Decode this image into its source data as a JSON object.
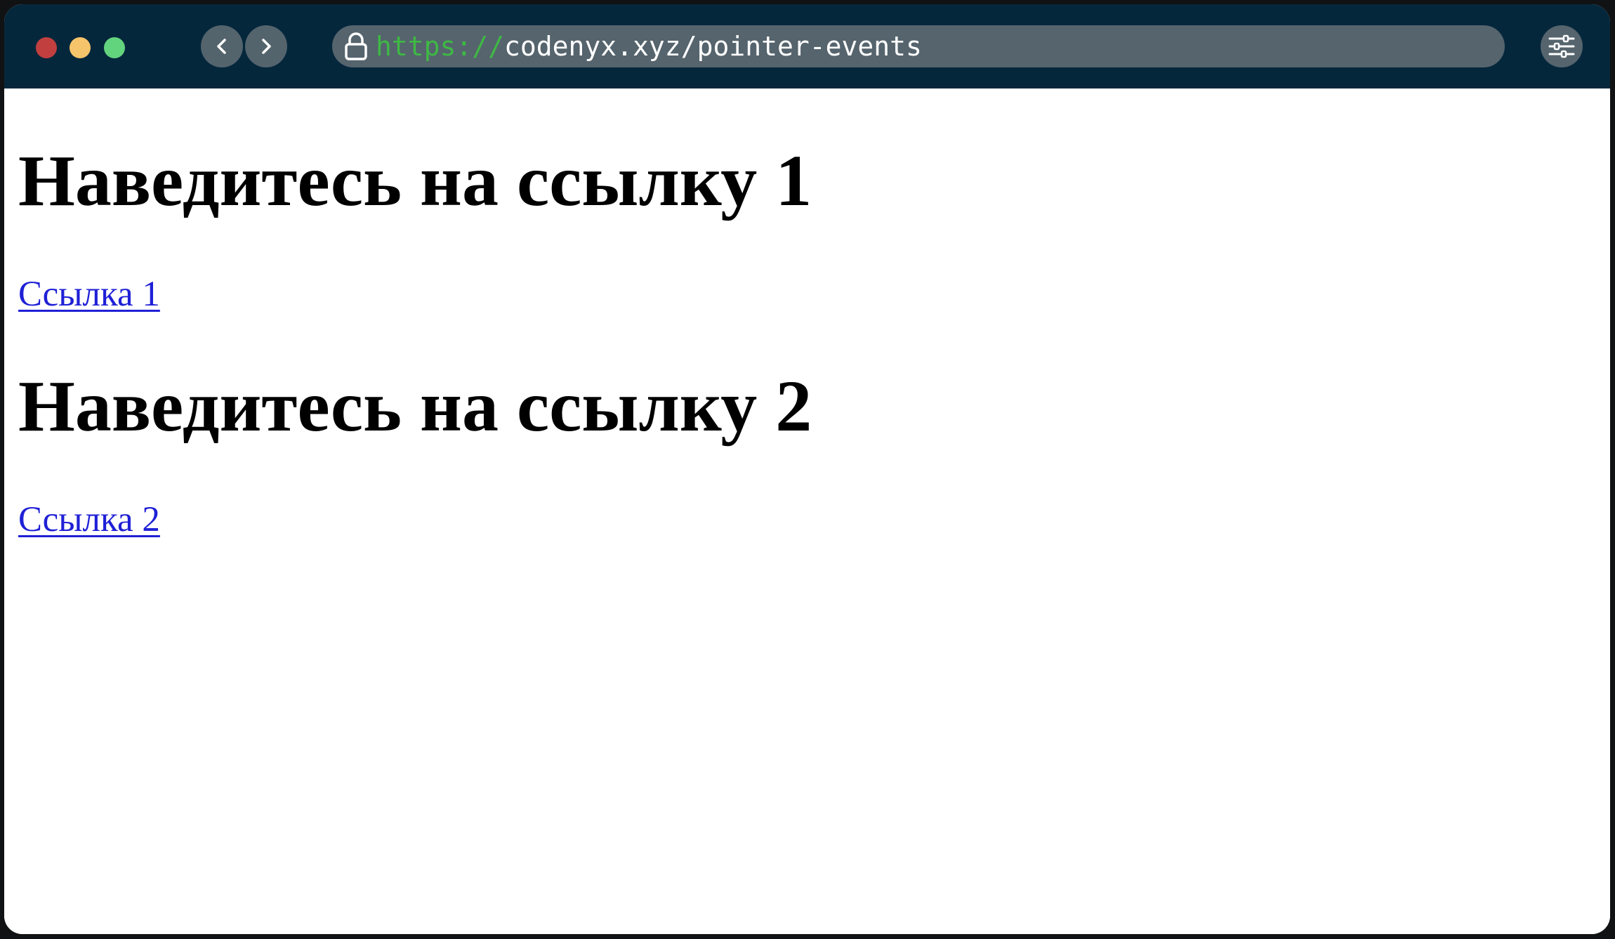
{
  "browser": {
    "url_scheme": "https://",
    "url_rest": "codenyx.xyz/pointer-events",
    "colors": {
      "titlebar": "#05273c",
      "url_scheme": "#3fb845",
      "control_bg": "#55646d"
    },
    "icons": {
      "back": "chevron-left-icon",
      "forward": "chevron-right-icon",
      "lock": "lock-icon",
      "settings": "sliders-icon"
    }
  },
  "page": {
    "heading_1": "Наведитесь на ссылку 1",
    "link_1": "Ссылка 1",
    "heading_2": "Наведитесь на ссылку 2",
    "link_2": "Ссылка 2",
    "colors": {
      "link": "#1f20d6",
      "text": "#000000"
    }
  }
}
